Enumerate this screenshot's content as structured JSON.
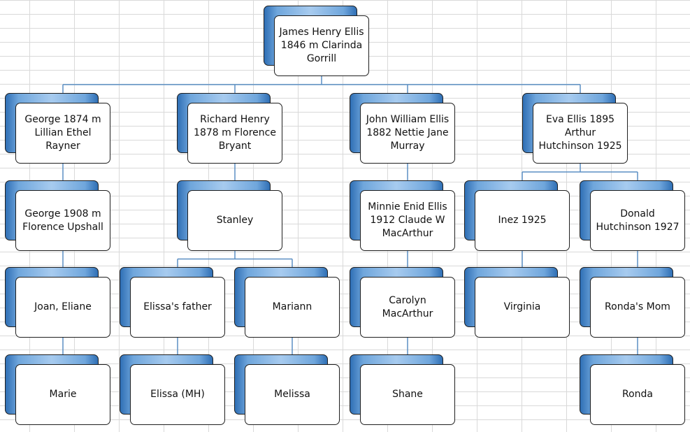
{
  "chart": {
    "nodes": [
      {
        "id": "root",
        "label": "James Henry Ellis 1846 m Clarinda Gorrill",
        "parent": null
      },
      {
        "id": "george",
        "label": "George 1874 m Lillian Ethel Rayner",
        "parent": "root"
      },
      {
        "id": "richard",
        "label": "Richard Henry 1878 m Florence Bryant",
        "parent": "root"
      },
      {
        "id": "john",
        "label": "John William Ellis 1882 Nettie Jane Murray",
        "parent": "root"
      },
      {
        "id": "eva",
        "label": "Eva Ellis 1895 Arthur Hutchinson 1925",
        "parent": "root"
      },
      {
        "id": "george2",
        "label": "George 1908 m Florence Upshall",
        "parent": "george"
      },
      {
        "id": "stanley",
        "label": "Stanley",
        "parent": "richard"
      },
      {
        "id": "minnie",
        "label": "Minnie Enid Ellis 1912 Claude W MacArthur",
        "parent": "john"
      },
      {
        "id": "inez",
        "label": "Inez 1925",
        "parent": "eva"
      },
      {
        "id": "donald",
        "label": "Donald Hutchinson 1927",
        "parent": "eva"
      },
      {
        "id": "joan",
        "label": "Joan, Eliane",
        "parent": "george2"
      },
      {
        "id": "efather",
        "label": "Elissa's father",
        "parent": "stanley"
      },
      {
        "id": "mariann",
        "label": "Mariann",
        "parent": "stanley"
      },
      {
        "id": "carolyn",
        "label": "Carolyn MacArthur",
        "parent": "minnie"
      },
      {
        "id": "virginia",
        "label": "Virginia",
        "parent": "inez"
      },
      {
        "id": "rmom",
        "label": "Ronda's Mom",
        "parent": "donald"
      },
      {
        "id": "marie",
        "label": "Marie",
        "parent": "joan"
      },
      {
        "id": "elissa",
        "label": "Elissa (MH)",
        "parent": "efather"
      },
      {
        "id": "melissa",
        "label": "Melissa",
        "parent": "mariann"
      },
      {
        "id": "shane",
        "label": "Shane",
        "parent": "carolyn"
      },
      {
        "id": "ronda",
        "label": "Ronda",
        "parent": "rmom"
      }
    ]
  }
}
